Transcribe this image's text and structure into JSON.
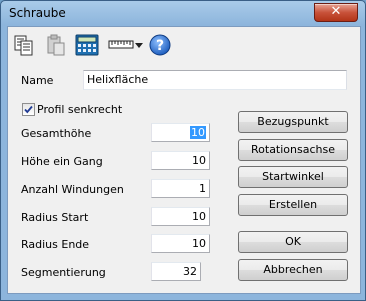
{
  "window": {
    "title": "Schraube",
    "close_glyph": "✕"
  },
  "toolbar": {
    "icons": [
      "copy-icon",
      "paste-icon",
      "calculator-icon",
      "ruler-icon",
      "dropdown-arrow-icon",
      "help-icon"
    ],
    "help_glyph": "?"
  },
  "name": {
    "label": "Name",
    "value": "Helixfläche"
  },
  "profil": {
    "label": "Profil senkrecht",
    "checked": true
  },
  "fields": [
    {
      "label": "Gesamthöhe",
      "value": "10"
    },
    {
      "label": "Höhe ein Gang",
      "value": "10"
    },
    {
      "label": "Anzahl Windungen",
      "value": "1"
    },
    {
      "label": "Radius Start",
      "value": "10"
    },
    {
      "label": "Radius Ende",
      "value": "10"
    },
    {
      "label": "Segmentierung",
      "value": "32"
    }
  ],
  "buttons": {
    "bezugspunkt": "Bezugspunkt",
    "rotationsachse": "Rotationsachse",
    "startwinkel": "Startwinkel",
    "erstellen": "Erstellen",
    "ok": "OK",
    "abbrechen": "Abbrechen"
  },
  "colors": {
    "selection": "#3399ff",
    "help": "#1f5fbf",
    "close": "#c8523a"
  }
}
